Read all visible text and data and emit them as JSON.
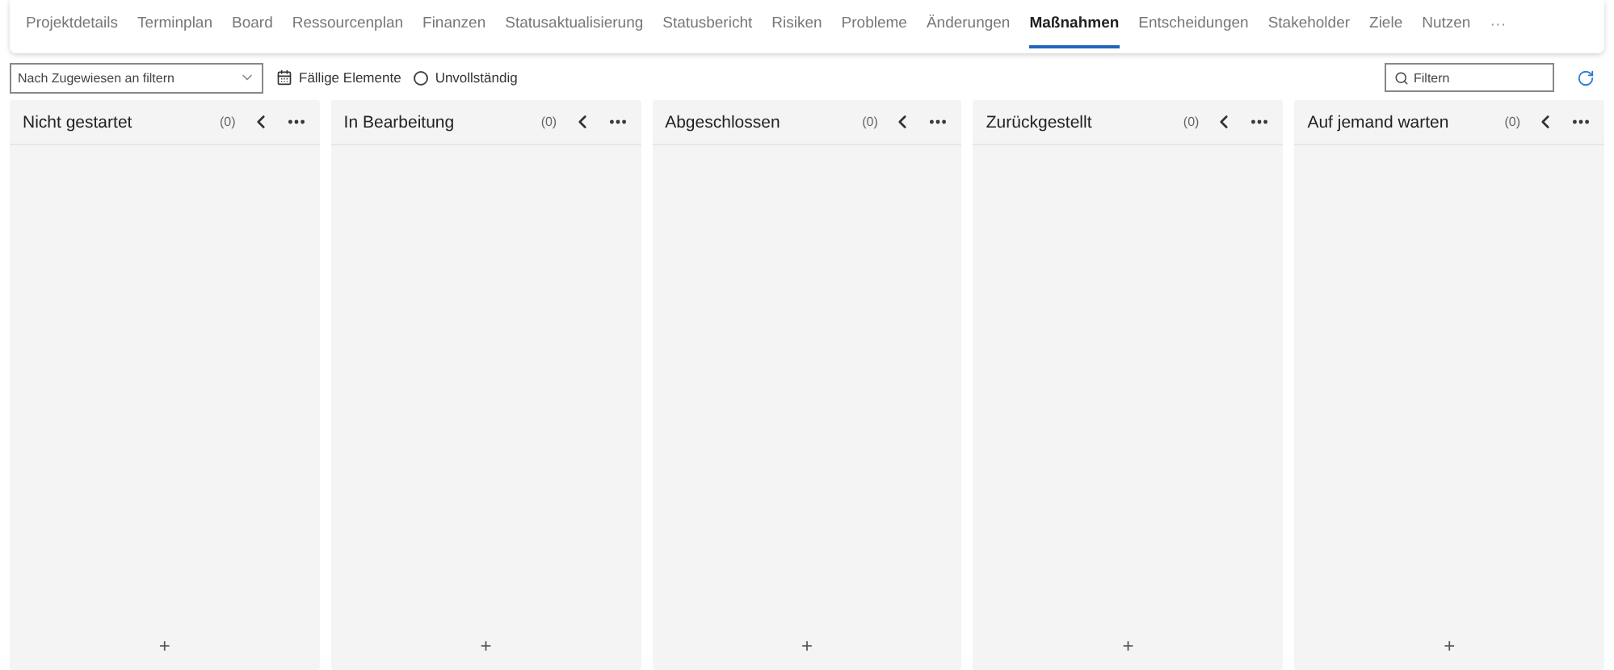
{
  "tabs": [
    {
      "label": "Projektdetails",
      "selected": false
    },
    {
      "label": "Terminplan",
      "selected": false
    },
    {
      "label": "Board",
      "selected": false
    },
    {
      "label": "Ressourcenplan",
      "selected": false
    },
    {
      "label": "Finanzen",
      "selected": false
    },
    {
      "label": "Statusaktualisierung",
      "selected": false
    },
    {
      "label": "Statusbericht",
      "selected": false
    },
    {
      "label": "Risiken",
      "selected": false
    },
    {
      "label": "Probleme",
      "selected": false
    },
    {
      "label": "Änderungen",
      "selected": false
    },
    {
      "label": "Maßnahmen",
      "selected": true
    },
    {
      "label": "Entscheidungen",
      "selected": false
    },
    {
      "label": "Stakeholder",
      "selected": false
    },
    {
      "label": "Ziele",
      "selected": false
    },
    {
      "label": "Nutzen",
      "selected": false
    }
  ],
  "tabs_overflow": "···",
  "toolbar": {
    "assignee_filter": {
      "placeholder": "Nach Zugewiesen an filtern"
    },
    "due_items": "Fällige Elemente",
    "incomplete": {
      "label": "Unvollständig",
      "checked": false
    },
    "search": {
      "placeholder": "Filtern"
    }
  },
  "columns": [
    {
      "title": "Nicht gestartet",
      "count": "(0)",
      "add": "+"
    },
    {
      "title": "In Bearbeitung",
      "count": "(0)",
      "add": "+"
    },
    {
      "title": "Abgeschlossen",
      "count": "(0)",
      "add": "+"
    },
    {
      "title": "Zurückgestellt",
      "count": "(0)",
      "add": "+"
    },
    {
      "title": "Auf jemand warten",
      "count": "(0)",
      "add": "+"
    }
  ]
}
